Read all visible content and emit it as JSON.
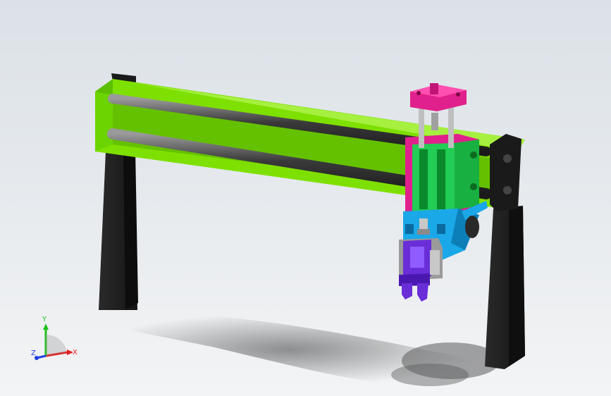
{
  "viewport": {
    "background_top": "#dbe1e7",
    "background_bottom": "#f3f4f5"
  },
  "model": {
    "colors": {
      "beam": "#7ee000",
      "beam_dark": "#4aa000",
      "legs": "#1f1f1f",
      "rods": "#3a3a3a",
      "carriage": "#22cc55",
      "magenta": "#e0208c",
      "cylinder": "#1aa8e8",
      "gripper": "#6a2ed8",
      "shadow": "#222222"
    }
  },
  "triad": {
    "x_label": "X",
    "y_label": "Y",
    "z_label": "Z",
    "x_color": "#e02020",
    "y_color": "#20c020",
    "z_color": "#2040e0"
  }
}
